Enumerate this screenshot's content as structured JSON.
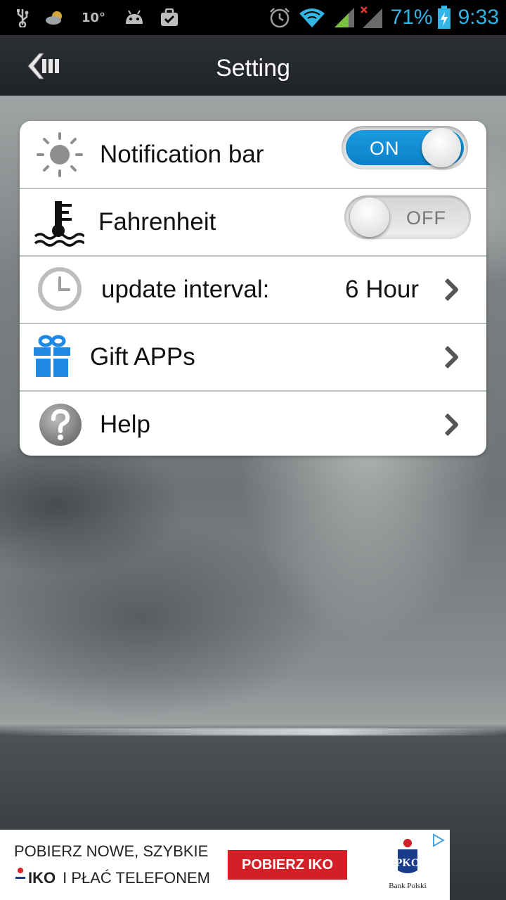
{
  "status_bar": {
    "temperature": "10°",
    "battery_percent": "71%",
    "time": "9:33",
    "accent_color": "#33b5e5",
    "icons": [
      "usb-icon",
      "weather-icon",
      "android-icon",
      "briefcase-icon",
      "alarm-icon",
      "wifi-icon",
      "signal-icon",
      "signal-no-data-icon",
      "battery-charging-icon"
    ]
  },
  "header": {
    "title": "Setting",
    "back_icon": "back-arrow-icon"
  },
  "settings": {
    "notification_bar": {
      "label": "Notification bar",
      "icon": "sun-icon",
      "toggle_text": "ON",
      "enabled": true
    },
    "fahrenheit": {
      "label": "Fahrenheit",
      "icon": "thermometer-icon",
      "toggle_text": "OFF",
      "enabled": false
    },
    "update_interval": {
      "label": "update interval:",
      "value": "6 Hour",
      "icon": "clock-icon"
    },
    "gift_apps": {
      "label": "Gift APPs",
      "icon": "gift-icon"
    },
    "help": {
      "label": "Help",
      "icon": "help-icon"
    }
  },
  "colors": {
    "toggle_on": "#0d8fd6",
    "gift_blue": "#1e88e5"
  },
  "ad": {
    "line1": "POBIERZ NOWE, SZYBKIE",
    "line2_brand": "IKO",
    "line2_rest": "I PŁAĆ TELEFONEM",
    "cta": "POBIERZ IKO",
    "logo_text": "Bank Polski",
    "brand_color": "#d31f26"
  }
}
